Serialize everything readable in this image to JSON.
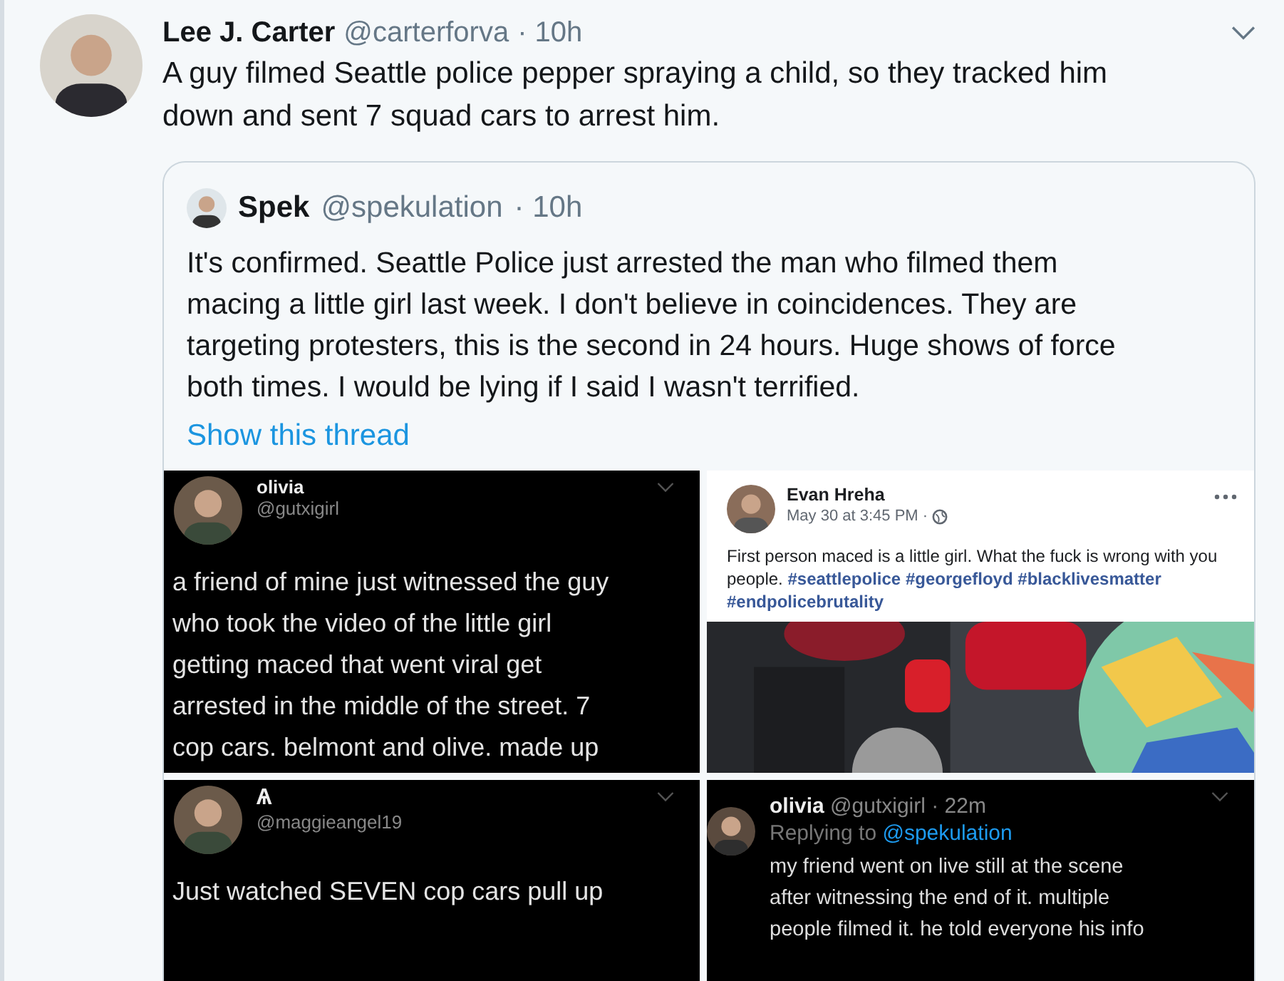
{
  "tweet": {
    "author": {
      "name": "Lee J. Carter",
      "handle": "@carterforva",
      "time": "· 10h"
    },
    "text": "A guy filmed Seattle police pepper spraying a child, so they tracked him\ndown and sent 7 squad cars to arrest him.",
    "quote": {
      "author": {
        "name": "Spek",
        "handle": "@spekulation",
        "time": "· 10h"
      },
      "text": "It's confirmed. Seattle Police just arrested the man who filmed them\nmacing a little girl last week. I don't believe in coincidences. They are\ntargeting protesters, this is the second in 24 hours. Huge shows of force\nboth times. I would be lying if I said I wasn't terrified.",
      "show_thread": "Show this thread",
      "media": [
        {
          "kind": "dark_tweet",
          "name": "olivia",
          "handle": "@gutxigirl",
          "text": "a friend of mine just witnessed the guy\nwho took the video of the little girl\ngetting maced that went viral get\narrested in the middle of the street. 7\ncop cars. belmont and olive. made up"
        },
        {
          "kind": "facebook_post",
          "name": "Evan Hreha",
          "date": "May 30 at 3:45 PM ·",
          "text": "First person maced is a little girl. What the fuck is wrong with you people.",
          "hashtags": [
            "#seattlepolice",
            "#georgefloyd",
            "#blacklivesmatter",
            "#endpolicebrutality"
          ]
        },
        {
          "kind": "dark_tweet",
          "name": "Ѧ",
          "handle": "@maggieangel19",
          "text": "Just watched SEVEN cop cars pull up"
        },
        {
          "kind": "dark_reply",
          "name": "olivia",
          "handle": "@gutxigirl · 22m",
          "replying": "Replying to",
          "reply_to": "@spekulation",
          "text": "my friend went on live still at the scene\nafter witnessing the end of it. multiple\npeople filmed it. he told everyone his info"
        }
      ]
    }
  }
}
